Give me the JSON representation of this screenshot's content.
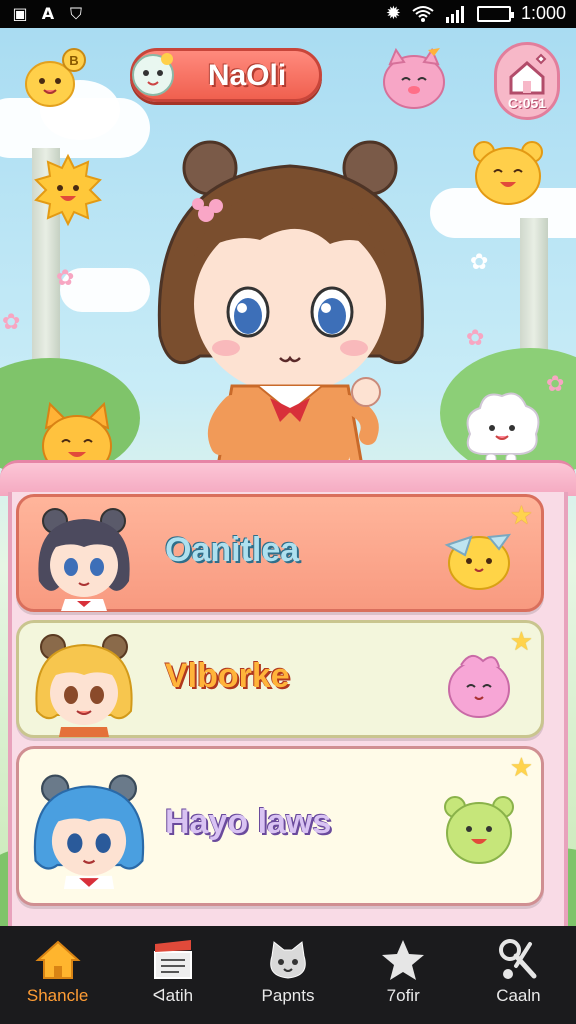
{
  "status_bar": {
    "time": "1:000",
    "left_icons": [
      "photo-icon",
      "font-icon",
      "shield-icon"
    ],
    "right_icons": [
      "brightness-icon",
      "wifi-icon",
      "signal-icon",
      "battery-icon"
    ]
  },
  "hud": {
    "player_name": "NaOli",
    "home_label": "C:051",
    "coin_badge": "B"
  },
  "list": {
    "items": [
      {
        "label": "Oanitlea"
      },
      {
        "label": "Vlborke"
      },
      {
        "label": "Hayo laws"
      }
    ]
  },
  "bottom_nav": {
    "items": [
      {
        "label": "Shancle",
        "icon": "home-icon",
        "active": true
      },
      {
        "label": "ᐊatih",
        "icon": "clapperboard-icon",
        "active": false
      },
      {
        "label": "Papnts",
        "icon": "cat-icon",
        "active": false
      },
      {
        "label": "7ofir",
        "icon": "star-icon",
        "active": false
      },
      {
        "label": "Caaln",
        "icon": "tools-icon",
        "active": false
      }
    ]
  },
  "colors": {
    "accent": "#ff9d35",
    "banner": "#f0604f",
    "panel": "#f9dbe6"
  }
}
